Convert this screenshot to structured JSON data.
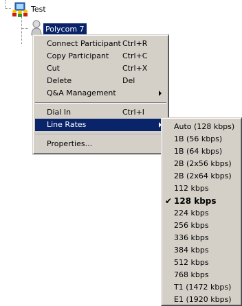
{
  "tree": {
    "conference_label": "Test",
    "participant_label": "Polycom 7"
  },
  "context_menu": {
    "items": [
      {
        "label": "Connect Participant",
        "shortcut": "Ctrl+R"
      },
      {
        "label": "Copy Participant",
        "shortcut": "Ctrl+C"
      },
      {
        "label": "Cut",
        "shortcut": "Ctrl+X"
      },
      {
        "label": "Delete",
        "shortcut": "Del"
      },
      {
        "label": "Q&A Management",
        "shortcut": ""
      },
      {
        "label": "Dial In",
        "shortcut": "Ctrl+I"
      },
      {
        "label": "Line Rates",
        "shortcut": ""
      },
      {
        "label": "Properties...",
        "shortcut": ""
      }
    ],
    "highlighted": "Line Rates"
  },
  "line_rates_menu": {
    "items": [
      "Auto (128 kbps)",
      "1B (56 kbps)",
      "1B (64 kbps)",
      "2B (2x56 kbps)",
      "2B (2x64 kbps)",
      "112 kbps",
      "128 kbps",
      "224 kbps",
      "256 kbps",
      "336 kbps",
      "384 kbps",
      "512 kbps",
      "768 kbps",
      "T1 (1472 kbps)",
      "E1 (1920 kbps)"
    ],
    "selected": "128 kbps",
    "check_glyph": "✔"
  },
  "colors": {
    "menu_bg": "#d4d0c8",
    "highlight": "#0a246a"
  }
}
